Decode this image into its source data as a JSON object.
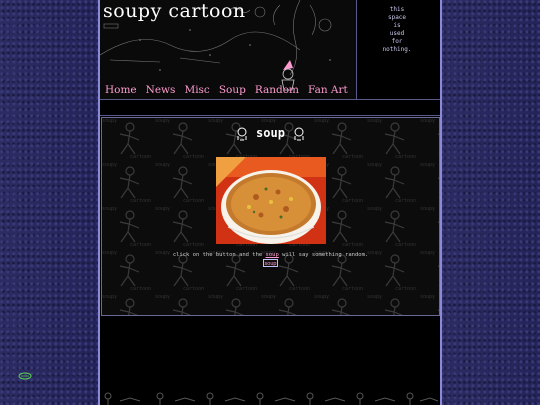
{
  "header": {
    "site_title": "soupy cartoon",
    "nav": [
      "Home",
      "News",
      "Misc",
      "Soup",
      "Random",
      "Fan Art"
    ]
  },
  "sidenote": "this\nspace\nis\nused\nfor\nnothing.",
  "panel": {
    "heading": "soup",
    "caption_before": "click on the button and the ",
    "caption_link": "soup",
    "caption_after": " will say something random.",
    "button_label": "soup",
    "watermark_text": "cartoon"
  },
  "colors": {
    "nav_link": "#ff9bd0",
    "side_background": "#26265a",
    "rail": "#8a8ad8"
  }
}
